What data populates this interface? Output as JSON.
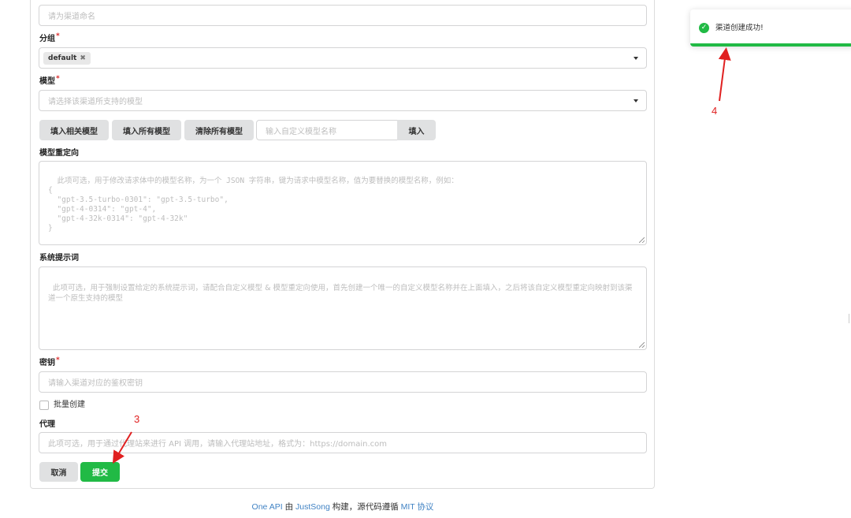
{
  "form": {
    "name_placeholder": "请为渠道命名",
    "group": {
      "label": "分组",
      "required_mark": "*",
      "chip": "default",
      "chip_remove": "✖"
    },
    "models": {
      "label": "模型",
      "required_mark": "*",
      "placeholder": "请选择该渠道所支持的模型",
      "buttons": [
        "填入相关模型",
        "填入所有模型",
        "清除所有模型"
      ],
      "custom_placeholder": "输入自定义模型名称",
      "fill_button": "填入"
    },
    "model_mapping": {
      "label": "模型重定向",
      "placeholder": "此项可选，用于修改请求体中的模型名称，为一个 JSON 字符串，键为请求中模型名称，值为要替换的模型名称，例如：\n{\n  \"gpt-3.5-turbo-0301\": \"gpt-3.5-turbo\",\n  \"gpt-4-0314\": \"gpt-4\",\n  \"gpt-4-32k-0314\": \"gpt-4-32k\"\n}"
    },
    "system_prompt": {
      "label": "系统提示词",
      "placeholder": "此项可选，用于强制设置给定的系统提示词，请配合自定义模型 & 模型重定向使用，首先创建一个唯一的自定义模型名称并在上面填入，之后将该自定义模型重定向映射到该渠道一个原生支持的模型"
    },
    "key": {
      "label": "密钥",
      "required_mark": "*",
      "placeholder": "请输入渠道对应的鉴权密钥"
    },
    "batch": {
      "label": "批量创建"
    },
    "proxy": {
      "label": "代理",
      "placeholder": "此项可选，用于通过代理站来进行 API 调用，请输入代理站地址，格式为：https://domain.com"
    },
    "cancel": "取消",
    "submit": "提交"
  },
  "footer": {
    "app": "One API",
    "by": " 由 ",
    "author": "JustSong",
    "mid": " 构建，源代码遵循 ",
    "license": "MIT 协议"
  },
  "toast": {
    "message": "渠道创建成功!",
    "icon": "check-circle-icon"
  },
  "annotations": {
    "step3": "3",
    "step4": "4"
  },
  "colors": {
    "primary_green": "#21ba45",
    "annotation_red": "#e02020",
    "link_blue": "#4183c4"
  }
}
